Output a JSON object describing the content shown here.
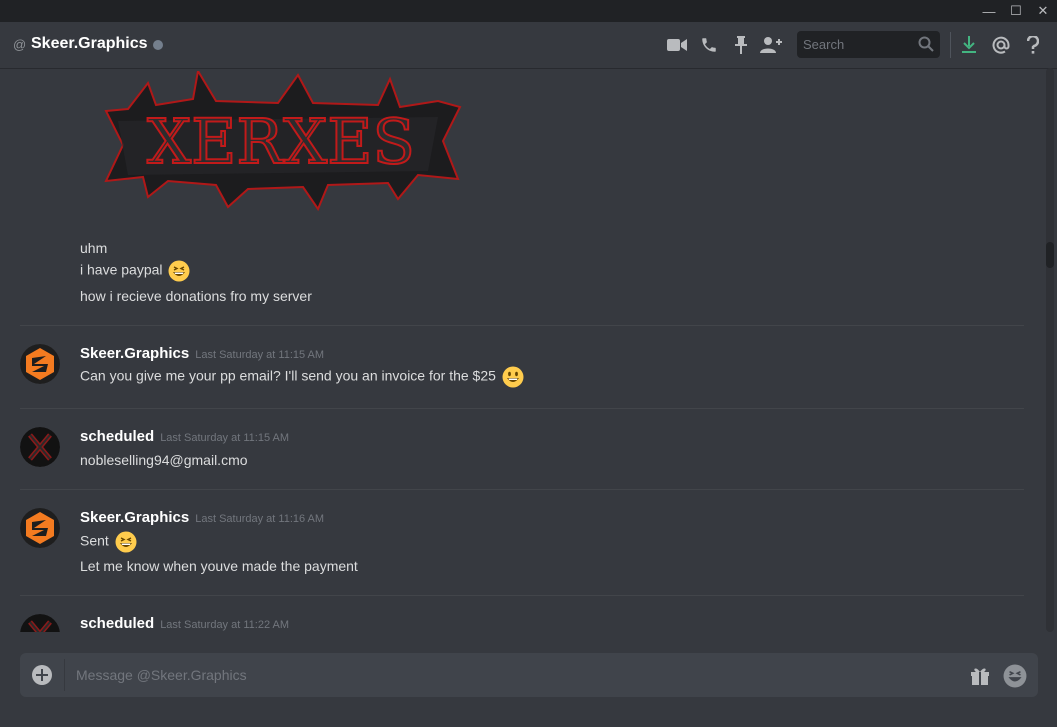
{
  "window": {
    "buttons": [
      {
        "name": "minimize-icon",
        "glyph": "—"
      },
      {
        "name": "maximize-icon",
        "glyph": "☐"
      },
      {
        "name": "close-icon",
        "glyph": "✕"
      }
    ]
  },
  "header": {
    "at_symbol": "@",
    "title": "Skeer.Graphics",
    "status": "offline",
    "icons": [
      "video-call-icon",
      "voice-call-icon",
      "pin-icon",
      "add-friend-icon",
      "download-icon",
      "mention-icon",
      "help-icon"
    ],
    "search_placeholder": "Search"
  },
  "banner": {
    "text": "XERXES"
  },
  "messages": {
    "continued": [
      {
        "text": "uhm"
      },
      {
        "text": "i have paypal",
        "emoji": "grinning-squint-emoji"
      },
      {
        "text": "how i recieve donations fro my server"
      }
    ],
    "groups": [
      {
        "author": "Skeer.Graphics",
        "timestamp": "Last Saturday at 11:15 AM",
        "lines": [
          {
            "text": "Can you give me your pp email? I'll send you an invoice for the $25",
            "emoji": "smiley-emoji"
          }
        ]
      },
      {
        "author": "scheduled",
        "timestamp": "Last Saturday at 11:15 AM",
        "lines": [
          {
            "text": "nobleselling94@gmail.cmo"
          }
        ]
      },
      {
        "author": "Skeer.Graphics",
        "timestamp": "Last Saturday at 11:16 AM",
        "lines": [
          {
            "text": "Sent",
            "emoji": "grinning-squint-emoji"
          },
          {
            "text": "Let me know when youve made the payment"
          }
        ]
      },
      {
        "author": "scheduled",
        "timestamp": "Last Saturday at 11:22 AM",
        "lines": []
      }
    ]
  },
  "composer": {
    "placeholder": "Message @Skeer.Graphics"
  },
  "colors": {
    "background": "#36393f",
    "titlebar": "#202225",
    "composer": "#40444b",
    "download_accent": "#43b581",
    "emoji_yellow": "#ffcc4d"
  }
}
